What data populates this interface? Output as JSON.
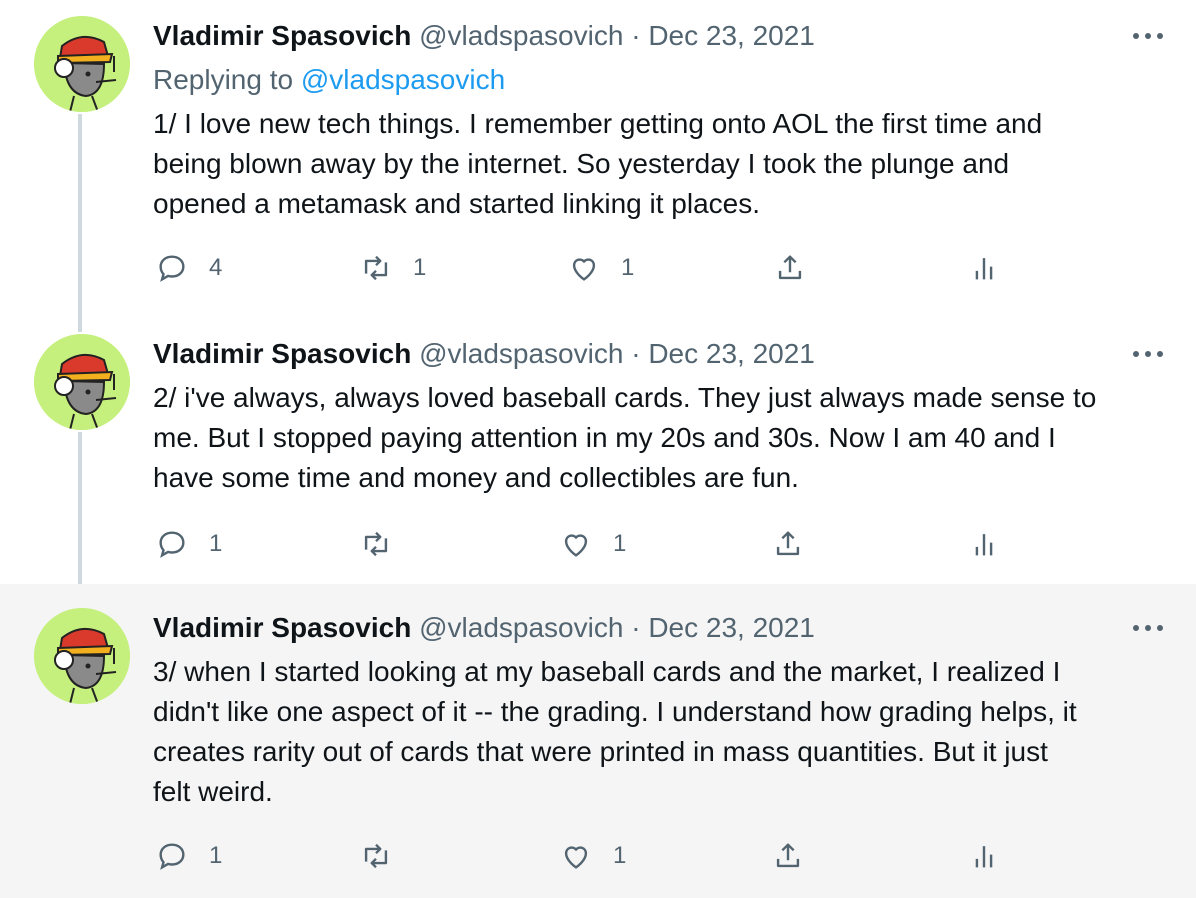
{
  "tweets": [
    {
      "name": "Vladimir Spasovich",
      "handle": "@vladspasovich",
      "separator": "·",
      "date": "Dec 23, 2021",
      "replying_label": "Replying to",
      "replying_handle": "@vladspasovich",
      "text": "1/ I love new tech things. I remember getting onto AOL the first time and\nbeing blown away by the internet. So yesterday I took the plunge and\nopened a metamask and started linking it places.",
      "replies": "4",
      "retweets": "1",
      "likes": "1"
    },
    {
      "name": "Vladimir Spasovich",
      "handle": "@vladspasovich",
      "separator": "·",
      "date": "Dec 23, 2021",
      "text": "2/ i've always, always loved baseball cards. They just always made sense to\nme. But I stopped paying attention in my 20s and 30s. Now I am 40 and I\nhave some time and money and collectibles are fun.",
      "replies": "1",
      "retweets": "",
      "likes": "1"
    },
    {
      "name": "Vladimir Spasovich",
      "handle": "@vladspasovich",
      "separator": "·",
      "date": "Dec 23, 2021",
      "text": "3/ when I started looking at my baseball cards and the market, I realized I\ndidn't like one aspect of it -- the grading. I understand how grading helps, it\ncreates rarity out of cards that were printed in mass quantities. But it just\nfelt weird.",
      "replies": "1",
      "retweets": "",
      "likes": "1"
    }
  ],
  "icons": {
    "reply": "reply-icon",
    "retweet": "retweet-icon",
    "like": "heart-icon",
    "share": "share-icon",
    "analytics": "analytics-icon",
    "more": "more-icon",
    "avatar": "cartoon-avatar"
  },
  "colors": {
    "text": "#0f1419",
    "muted": "#536471",
    "link": "#1d9bf0",
    "thread_line": "#cfd9de",
    "highlight_bg": "#f5f5f5",
    "avatar_bg": "#c6f07e"
  }
}
